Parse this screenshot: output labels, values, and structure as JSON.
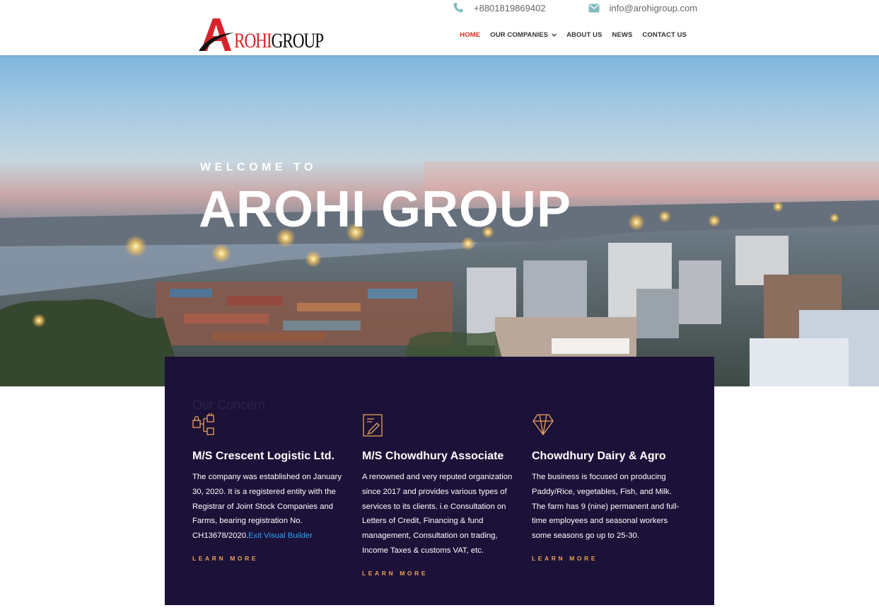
{
  "topbar": {
    "phone": "+8801819869402",
    "email": "info@arohigroup.com",
    "phone_icon": "phone-icon",
    "email_icon": "envelope-icon"
  },
  "logo": {
    "text_red": "ROHI",
    "text_black": "GROUP"
  },
  "nav": {
    "items": [
      {
        "label": "HOME"
      },
      {
        "label": "OUR COMPANIES"
      },
      {
        "label": "ABOUT US"
      },
      {
        "label": "NEWS"
      },
      {
        "label": "CONTACT US"
      }
    ]
  },
  "hero": {
    "subtitle": "WELCOME TO",
    "title": "AROHI GROUP"
  },
  "concern": {
    "heading": "Our Concern",
    "cards": [
      {
        "icon": "hierarchy-icon",
        "title": "M/S Crescent Logistic Ltd.",
        "body": "The company was established on January 30, 2020. It is a registered entity with the Registrar of Joint Stock Companies and Farms, bearing registration No. CH13678/2020.",
        "link": "Exit Visual Builder",
        "more": "LEARN MORE"
      },
      {
        "icon": "document-pen-icon",
        "title": "M/S Chowdhury Associate",
        "body": "A renowned and very reputed organization since 2017 and provides various types of services to its clients. i.e Consultation on Letters of Credit, Financing & fund management, Consultation on trading, Income Taxes & customs VAT, etc.",
        "more": "LEARN MORE"
      },
      {
        "icon": "diamond-icon",
        "title": "Chowdhury Dairy & Agro",
        "body": "The business is focused on producing Paddy/Rice, vegetables, Fish, and Milk. The farm has 9 (nine) permanent and full-time employees and seasonal workers some seasons go up to 25-30.",
        "more": "LEARN MORE"
      }
    ]
  },
  "colors": {
    "accent_red": "#e02b20",
    "concern_bg": "#1c1138",
    "learn_more": "#e9a25a",
    "link_blue": "#2ea3f2",
    "icon_color": "#e9a25a"
  }
}
